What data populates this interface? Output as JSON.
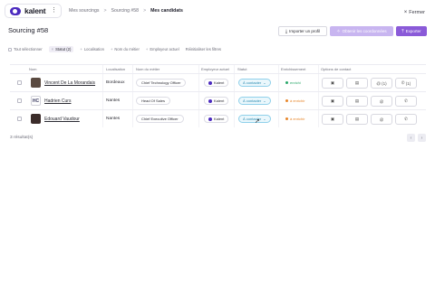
{
  "brand": {
    "name": "kalent",
    "menu_icon": "kebab-icon"
  },
  "breadcrumb": {
    "items": [
      "Mes sourcings",
      "Sourcing #58",
      "Mes candidats"
    ],
    "separator": ">"
  },
  "header": {
    "close_label": "Fermer",
    "title": "Sourcing #58"
  },
  "actions": {
    "import_label": "Importer un profil",
    "obtain_label": "Obtenir les coordonnées",
    "export_label": "Exporter"
  },
  "filters": {
    "select_all": "Tout sélectionner",
    "status": "Statut (2)",
    "location": "Localisation",
    "job": "Nom du métier",
    "employer": "Employeur actuel",
    "reset": "Réinitialiser les filtres"
  },
  "table": {
    "headers": {
      "name": "Nom",
      "location": "Localisation",
      "job": "Nom du métier",
      "employer": "Employeur actuel",
      "status": "Statut",
      "enrichment": "Enrichissement",
      "contact": "Options de contact"
    },
    "rows": [
      {
        "name": "Vincent De La Morandais",
        "location": "Bordeaux",
        "job": "Chief Technology Officer",
        "employer": "Kalent",
        "status": "À contacter",
        "enrichment": "enrichi",
        "enrichment_color": "#2aa86a",
        "email_count": "(1)",
        "phone_count": "(1)"
      },
      {
        "name": "Hadrien Curs",
        "initials": "HC",
        "location": "Nantes",
        "job": "Head Of Sales",
        "employer": "Kalent",
        "status": "À contacter",
        "enrichment": "à enrichir",
        "enrichment_color": "#e8862a"
      },
      {
        "name": "Edouard Vaudour",
        "location": "Nantes",
        "job": "Chief Executive Officer",
        "employer": "Kalent",
        "status": "À contacter",
        "enrichment": "à enrichir",
        "enrichment_color": "#e8862a"
      }
    ]
  },
  "footer": {
    "results": "3 résultat(s)"
  }
}
